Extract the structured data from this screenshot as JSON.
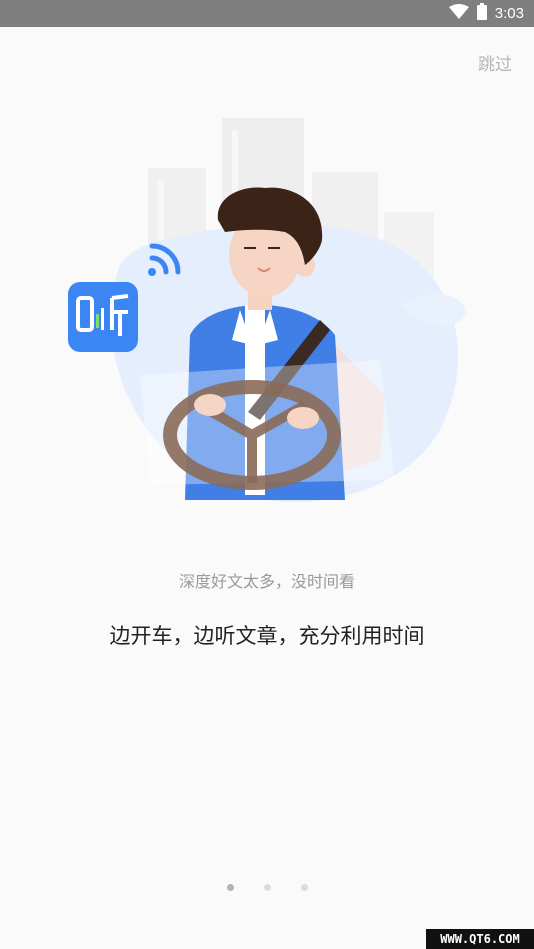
{
  "status_bar": {
    "time": "3:03",
    "icons": [
      "wifi-icon",
      "battery-icon"
    ]
  },
  "header": {
    "skip_label": "跳过"
  },
  "illustration": {
    "app_icon_text": "听",
    "colors": {
      "accent_blue": "#3b86f3",
      "shirt_blue": "#3f7fe6",
      "hair": "#3b2417",
      "wheel": "#8a6b58"
    }
  },
  "content": {
    "subtitle": "深度好文太多，没时间看",
    "title": "边开车，边听文章，充分利用时间"
  },
  "pager": {
    "current": 1,
    "total": 3
  },
  "watermark": {
    "text": "WWW.QT6.COM"
  }
}
